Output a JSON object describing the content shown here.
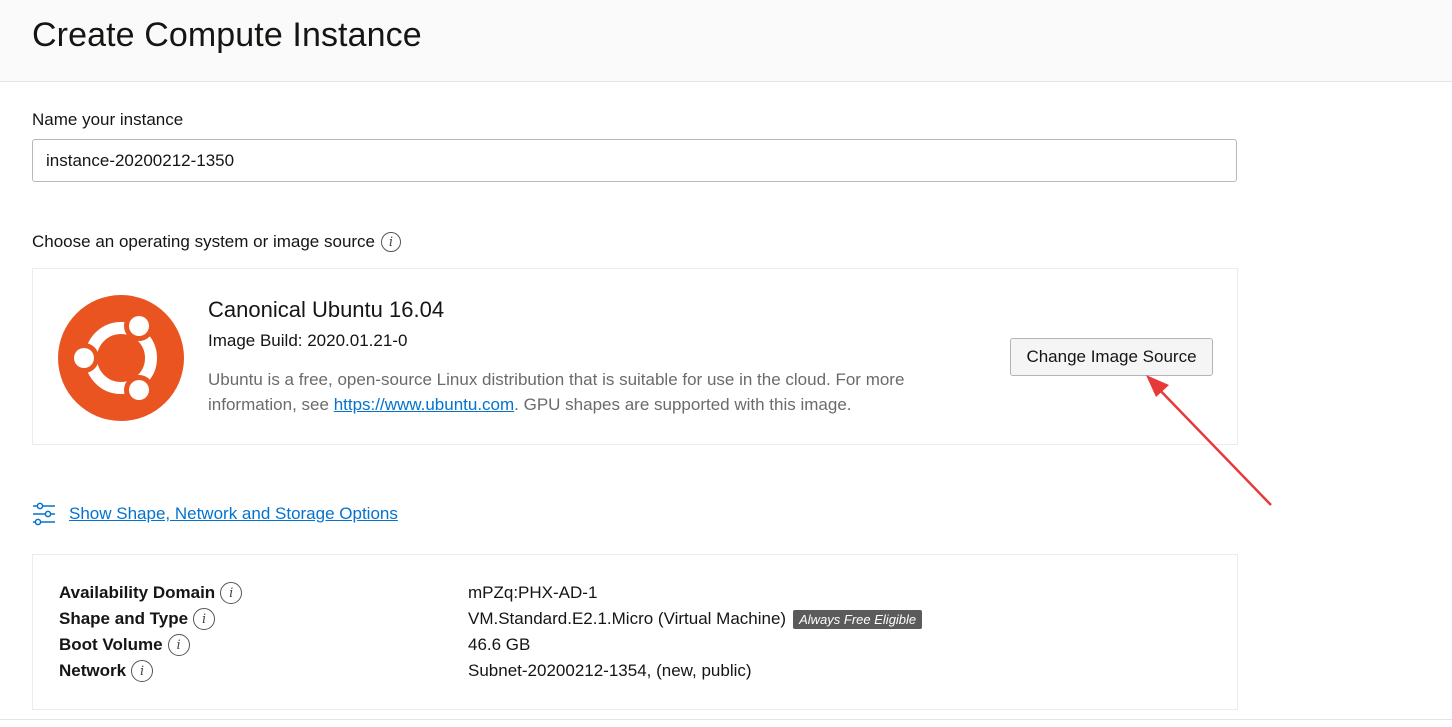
{
  "header": {
    "title": "Create Compute Instance"
  },
  "name_section": {
    "label": "Name your instance",
    "value": "instance-20200212-1350"
  },
  "image_section": {
    "label": "Choose an operating system or image source",
    "info_icon": "info-icon",
    "image_name": "Canonical Ubuntu 16.04",
    "image_build": "Image Build: 2020.01.21-0",
    "desc_before_link": "Ubuntu is a free, open-source Linux distribution that is suitable for use in the cloud. For more information, see ",
    "desc_link": "https://www.ubuntu.com",
    "desc_after_link": ". GPU shapes are supported with this image.",
    "change_button": "Change Image Source",
    "logo_icon": "ubuntu-logo",
    "logo_color": "#e95420"
  },
  "options_link": {
    "icon": "sliders-icon",
    "label": "Show Shape, Network and Storage Options"
  },
  "summary": {
    "rows": [
      {
        "key": "Availability Domain",
        "value": "mPZq:PHX-AD-1"
      },
      {
        "key": "Shape and Type",
        "value": "VM.Standard.E2.1.Micro (Virtual Machine)",
        "badge": "Always Free Eligible"
      },
      {
        "key": "Boot Volume",
        "value": "46.6 GB"
      },
      {
        "key": "Network",
        "value": "Subnet-20200212-1354, (new, public)"
      }
    ]
  },
  "annotation": {
    "arrow_color": "#e8393a"
  },
  "colors": {
    "link": "#0572ce",
    "text": "#161513",
    "muted": "#6b6b6b"
  }
}
